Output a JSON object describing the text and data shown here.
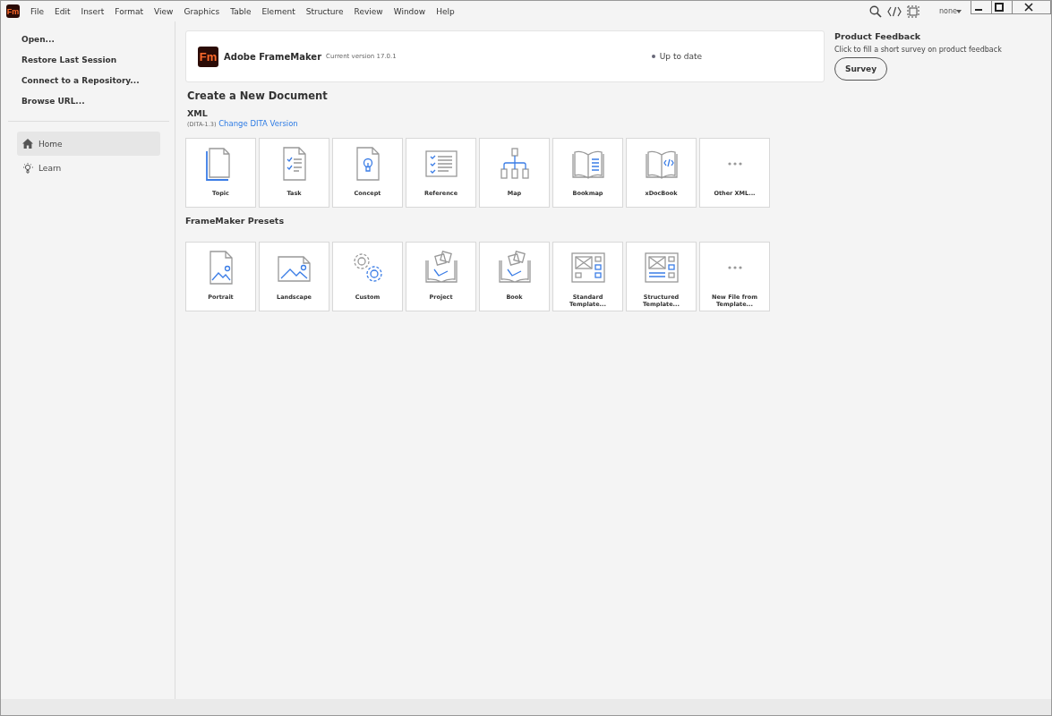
{
  "app_logo": "Fm",
  "menu": [
    "File",
    "Edit",
    "Insert",
    "Format",
    "View",
    "Graphics",
    "Table",
    "Element",
    "Structure",
    "Review",
    "Window",
    "Help"
  ],
  "toolbar": {
    "workspace": "none"
  },
  "sidebar": {
    "actions": [
      "Open...",
      "Restore Last Session",
      "Connect to a Repository...",
      "Browse URL..."
    ],
    "nav": [
      {
        "label": "Home",
        "kind": "home",
        "selected": true
      },
      {
        "label": "Learn",
        "kind": "learn",
        "selected": false
      }
    ]
  },
  "header": {
    "logo": "Fm",
    "product": "Adobe FrameMaker",
    "version": "Current version 17.0.1",
    "status": "Up to date"
  },
  "create": {
    "title": "Create a New Document",
    "xml_title": "XML",
    "dita": "(DITA-1.3)",
    "dita_link": "Change DITA Version",
    "xml_tiles": [
      {
        "label": "Topic",
        "kind": "topic"
      },
      {
        "label": "Task",
        "kind": "task"
      },
      {
        "label": "Concept",
        "kind": "concept"
      },
      {
        "label": "Reference",
        "kind": "reference"
      },
      {
        "label": "Map",
        "kind": "map"
      },
      {
        "label": "Bookmap",
        "kind": "bookmap"
      },
      {
        "label": "xDocBook",
        "kind": "xdocbook"
      },
      {
        "label": "Other XML...",
        "kind": "more"
      }
    ],
    "presets_title": "FrameMaker Presets",
    "preset_tiles": [
      {
        "label": "Portrait",
        "kind": "portrait"
      },
      {
        "label": "Landscape",
        "kind": "landscape"
      },
      {
        "label": "Custom",
        "kind": "custom"
      },
      {
        "label": "Project",
        "kind": "project"
      },
      {
        "label": "Book",
        "kind": "book"
      },
      {
        "label": "Standard Template...",
        "kind": "template"
      },
      {
        "label": "Structured Template...",
        "kind": "stemplate"
      },
      {
        "label": "New File from Template...",
        "kind": "more"
      }
    ]
  },
  "feedback": {
    "title": "Product Feedback",
    "text": "Click to fill a short survey on product feedback",
    "button": "Survey"
  }
}
